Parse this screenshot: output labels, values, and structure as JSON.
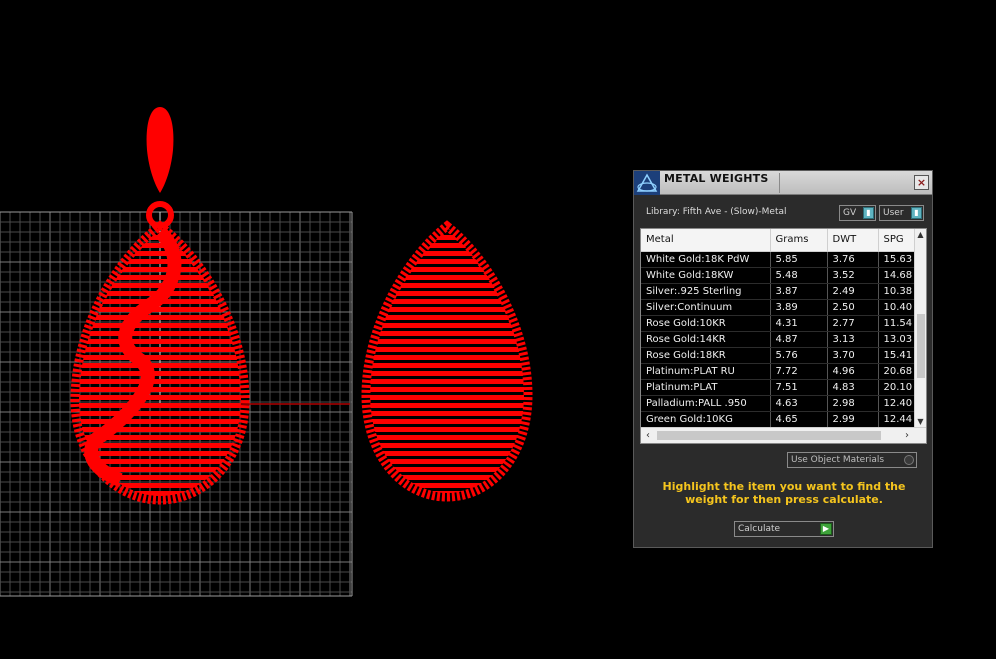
{
  "panel": {
    "title": "METAL WEIGHTS",
    "close_label": "×",
    "library_label": "Library: Fifth Ave - (Slow)-Metal",
    "gv_select": "GV",
    "user_select": "User",
    "columns": [
      "Metal",
      "Grams",
      "DWT",
      "SPG"
    ],
    "rows": [
      [
        "White Gold:18K PdW",
        "5.85",
        "3.76",
        "15.63"
      ],
      [
        "White Gold:18KW",
        "5.48",
        "3.52",
        "14.68"
      ],
      [
        "Silver:.925 Sterling",
        "3.87",
        "2.49",
        "10.38"
      ],
      [
        "Silver:Continuum",
        "3.89",
        "2.50",
        "10.40"
      ],
      [
        "Rose Gold:10KR",
        "4.31",
        "2.77",
        "11.54"
      ],
      [
        "Rose Gold:14KR",
        "4.87",
        "3.13",
        "13.03"
      ],
      [
        "Rose Gold:18KR",
        "5.76",
        "3.70",
        "15.41"
      ],
      [
        "Platinum:PLAT RU",
        "7.72",
        "4.96",
        "20.68"
      ],
      [
        "Platinum:PLAT",
        "7.51",
        "4.83",
        "20.10"
      ],
      [
        "Palladium:PALL .950",
        "4.63",
        "2.98",
        "12.40"
      ],
      [
        "Green Gold:10KG",
        "4.65",
        "2.99",
        "12.44"
      ]
    ],
    "use_object_materials": "Use Object Materials",
    "hint": "Highlight the item you want to find the weight for then press calculate.",
    "calculate_label": "Calculate"
  },
  "colors": {
    "model": "#ff0000",
    "grid": "#6e6e6e",
    "panel_bg": "#2b2b2b",
    "hint": "#f5c51e",
    "accent_teal": "#5fb3c0",
    "go_green": "#3ea33a"
  },
  "icons": {
    "app": "rhino-logo-icon",
    "close": "close-icon",
    "scroll_up": "scroll-up-arrow-icon",
    "scroll_down": "scroll-down-arrow-icon",
    "scroll_left": "scroll-left-arrow-icon",
    "scroll_right": "scroll-right-arrow-icon",
    "calculate_go": "play-arrow-icon"
  }
}
